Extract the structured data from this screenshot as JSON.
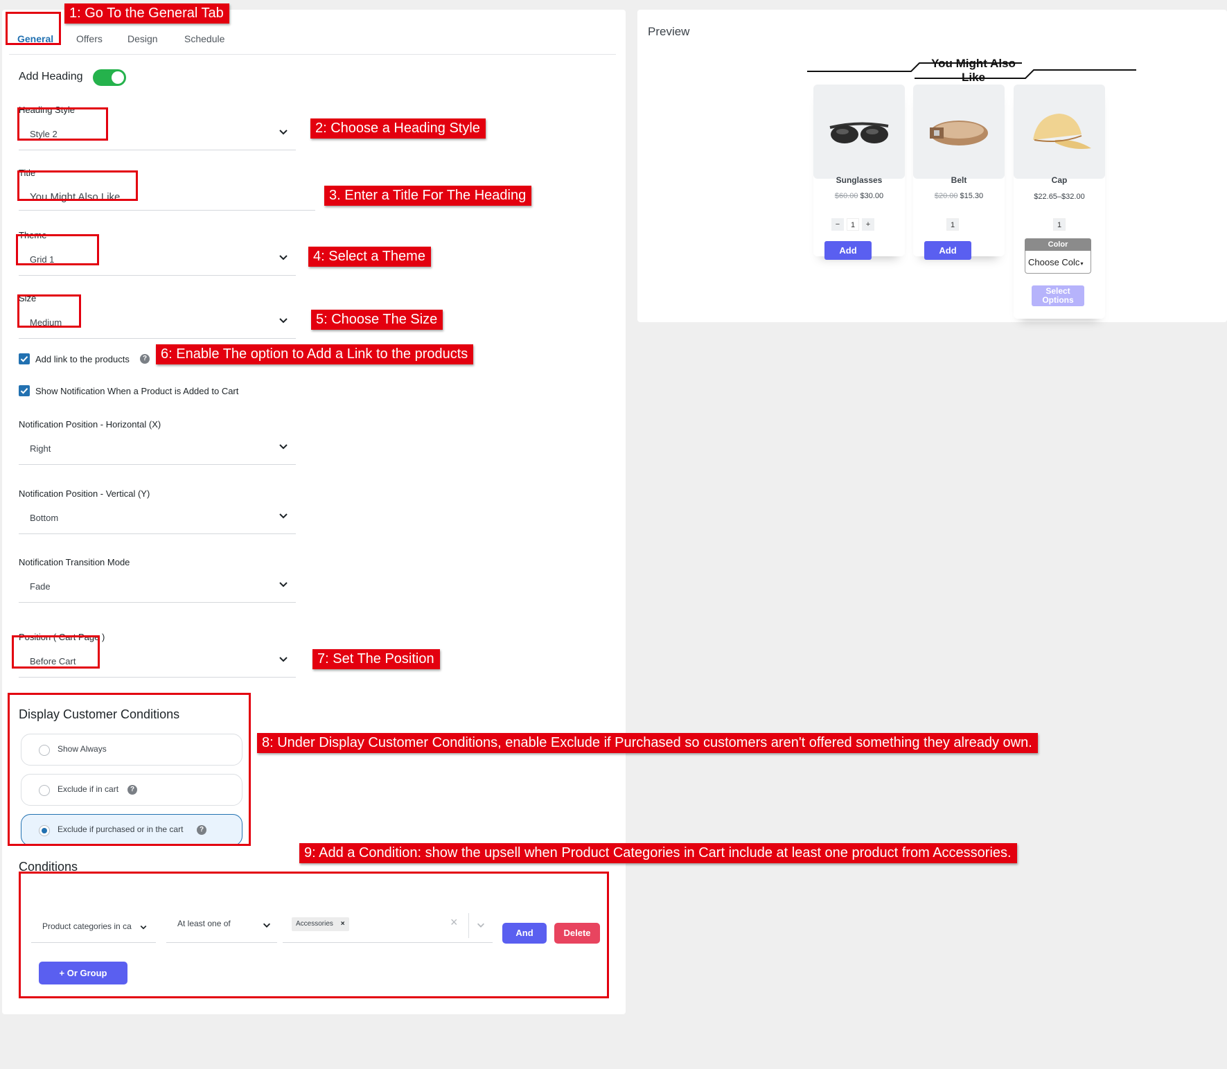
{
  "tabs": [
    "General",
    "Offers",
    "Design",
    "Schedule"
  ],
  "form": {
    "add_heading_label": "Add Heading",
    "heading_style_label": "Heading Style",
    "heading_style_value": "Style 2",
    "title_label": "Title",
    "title_value": "You Might Also Like",
    "theme_label": "Theme",
    "theme_value": "Grid 1",
    "size_label": "Size",
    "size_value": "Medium",
    "add_link_label": "Add link to the products",
    "show_notification_label": "Show Notification When a Product is Added to Cart",
    "notif_x_label": "Notification Position - Horizontal (X)",
    "notif_x_value": "Right",
    "notif_y_label": "Notification Position - Vertical (Y)",
    "notif_y_value": "Bottom",
    "transition_label": "Notification Transition Mode",
    "transition_value": "Fade",
    "position_label": "Position ( Cart Page )",
    "position_value": "Before Cart",
    "conditions_section_title": "Display Customer Conditions",
    "radio_options": [
      "Show Always",
      "Exclude if in cart",
      "Exclude if purchased or in the cart"
    ],
    "conditions_title": "Conditions",
    "condition_field": "Product categories in ca",
    "condition_operator": "At least one of",
    "condition_tag": "Accessories",
    "and_button": "And",
    "delete_button": "Delete",
    "or_group_button": "+ Or Group"
  },
  "callouts": {
    "c1": "1: Go To the General Tab",
    "c2": "2: Choose a Heading Style",
    "c3": "3. Enter a Title For The Heading",
    "c4": "4: Select a Theme",
    "c5": "5: Choose The Size",
    "c6": "6: Enable The option to Add a Link to the products",
    "c7": "7: Set The Position",
    "c8": "8: Under Display Customer Conditions, enable Exclude if Purchased so customers aren't offered something they already own.",
    "c9": "9: Add a Condition: show the upsell when Product Categories in Cart include at least one product from Accessories."
  },
  "preview": {
    "label": "Preview",
    "heading": "You Might Also Like",
    "products": [
      {
        "name": "Sunglasses",
        "old_price": "$60.00",
        "price": "$30.00",
        "qty": "1",
        "button": "Add"
      },
      {
        "name": "Belt",
        "old_price": "$20.00",
        "price": "$15.30",
        "qty": "1",
        "button": "Add"
      },
      {
        "name": "Cap",
        "price": "$22.65–$32.00",
        "qty": "1",
        "color_label": "Color",
        "color_select": "Choose Colc",
        "button": "Select Options"
      }
    ]
  },
  "colors": {
    "accent": "#2271b1",
    "callout_red": "#e3000f",
    "toggle_green": "#25b24c",
    "button_purple": "#5a5ff0",
    "delete_red": "#e8445f"
  }
}
